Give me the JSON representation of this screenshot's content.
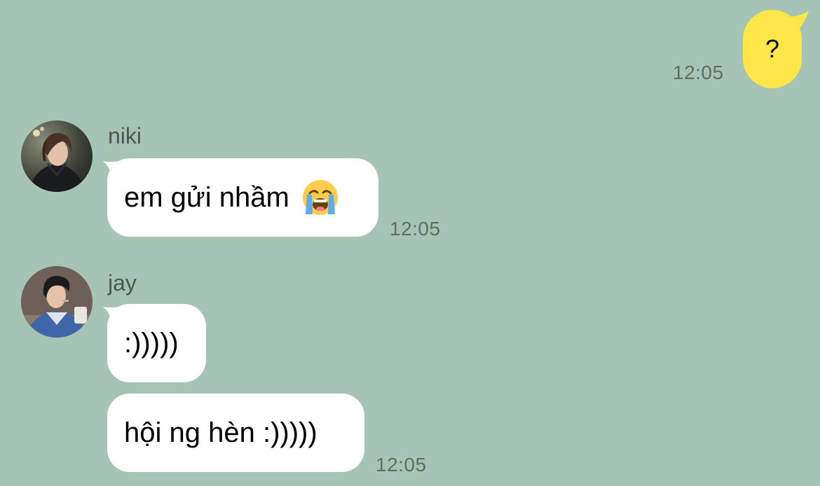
{
  "colors": {
    "background": "#a6c4b6",
    "outgoing_bubble": "#ffe649",
    "incoming_bubble": "#ffffff",
    "timestamp_text": "#5f6e67",
    "sender_name_text": "#4a5852"
  },
  "outgoing": {
    "text": "?",
    "time": "12:05"
  },
  "niki": {
    "name": "niki",
    "avatar_icon": "profile-photo",
    "message": "em gửi nhầm",
    "emoji_icon": "loudly-crying-face-icon",
    "time": "12:05"
  },
  "jay": {
    "name": "jay",
    "avatar_icon": "profile-photo",
    "message1": ":)))))",
    "message2": "hội ng hèn :)))))",
    "time": "12:05"
  }
}
